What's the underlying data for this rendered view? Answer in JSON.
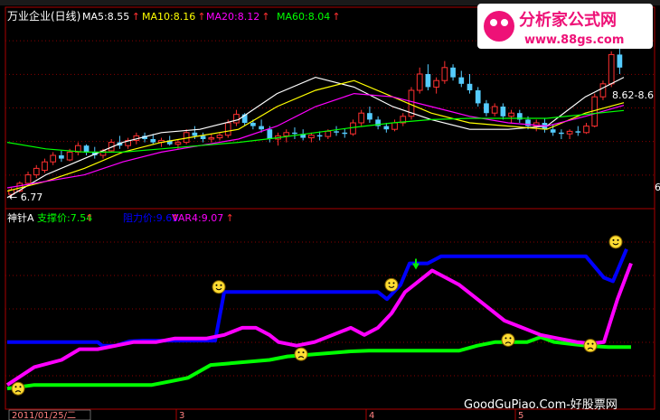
{
  "chart_data": [
    {
      "type": "candlestick",
      "title": "万业企业(日线)",
      "indicators": [
        {
          "label": "MA5:8.55",
          "color": "#ffffff"
        },
        {
          "label": "MA10:8.16",
          "color": "#ffff00"
        },
        {
          "label": "MA20:8.12",
          "color": "#ff00ff"
        },
        {
          "label": "MA60:8.04",
          "color": "#00ff00"
        }
      ],
      "arrow": "↑",
      "ylim": [
        6.6,
        9.35
      ],
      "min_label": "← 6.77",
      "range_label": "8.62-8.6",
      "right_tick": "6",
      "candles": [
        [
          6.75,
          6.85,
          6.7,
          6.82
        ],
        [
          6.8,
          6.95,
          6.78,
          6.92
        ],
        [
          6.92,
          7.1,
          6.9,
          7.05
        ],
        [
          7.05,
          7.2,
          7.0,
          7.15
        ],
        [
          7.12,
          7.3,
          7.08,
          7.25
        ],
        [
          7.25,
          7.4,
          7.2,
          7.35
        ],
        [
          7.35,
          7.42,
          7.25,
          7.3
        ],
        [
          7.28,
          7.45,
          7.26,
          7.4
        ],
        [
          7.4,
          7.55,
          7.35,
          7.5
        ],
        [
          7.5,
          7.52,
          7.35,
          7.4
        ],
        [
          7.4,
          7.48,
          7.3,
          7.35
        ],
        [
          7.35,
          7.45,
          7.3,
          7.42
        ],
        [
          7.42,
          7.6,
          7.4,
          7.55
        ],
        [
          7.55,
          7.65,
          7.45,
          7.5
        ],
        [
          7.5,
          7.62,
          7.45,
          7.58
        ],
        [
          7.58,
          7.7,
          7.52,
          7.65
        ],
        [
          7.65,
          7.7,
          7.55,
          7.6
        ],
        [
          7.6,
          7.68,
          7.52,
          7.55
        ],
        [
          7.55,
          7.62,
          7.48,
          7.58
        ],
        [
          7.58,
          7.65,
          7.5,
          7.52
        ],
        [
          7.52,
          7.6,
          7.45,
          7.55
        ],
        [
          7.55,
          7.75,
          7.52,
          7.7
        ],
        [
          7.7,
          7.8,
          7.6,
          7.65
        ],
        [
          7.65,
          7.7,
          7.55,
          7.6
        ],
        [
          7.6,
          7.68,
          7.55,
          7.62
        ],
        [
          7.62,
          7.7,
          7.58,
          7.66
        ],
        [
          7.66,
          7.9,
          7.62,
          7.85
        ],
        [
          7.85,
          8.05,
          7.8,
          7.98
        ],
        [
          7.98,
          8.0,
          7.8,
          7.85
        ],
        [
          7.85,
          7.9,
          7.75,
          7.8
        ],
        [
          7.8,
          7.9,
          7.7,
          7.75
        ],
        [
          7.75,
          7.8,
          7.55,
          7.6
        ],
        [
          7.6,
          7.7,
          7.5,
          7.65
        ],
        [
          7.65,
          7.75,
          7.55,
          7.7
        ],
        [
          7.7,
          7.78,
          7.6,
          7.68
        ],
        [
          7.68,
          7.75,
          7.58,
          7.62
        ],
        [
          7.62,
          7.7,
          7.55,
          7.66
        ],
        [
          7.66,
          7.72,
          7.58,
          7.64
        ],
        [
          7.64,
          7.75,
          7.6,
          7.72
        ],
        [
          7.72,
          7.8,
          7.65,
          7.7
        ],
        [
          7.7,
          7.76,
          7.62,
          7.68
        ],
        [
          7.68,
          7.9,
          7.65,
          7.85
        ],
        [
          7.85,
          8.05,
          7.8,
          8.0
        ],
        [
          8.0,
          8.1,
          7.85,
          7.9
        ],
        [
          7.9,
          7.95,
          7.75,
          7.8
        ],
        [
          7.8,
          7.85,
          7.7,
          7.75
        ],
        [
          7.75,
          7.9,
          7.72,
          7.85
        ],
        [
          7.85,
          8.0,
          7.8,
          7.95
        ],
        [
          7.95,
          8.4,
          7.9,
          8.35
        ],
        [
          8.35,
          8.7,
          8.3,
          8.6
        ],
        [
          8.6,
          8.75,
          8.35,
          8.4
        ],
        [
          8.4,
          8.55,
          8.3,
          8.5
        ],
        [
          8.5,
          8.8,
          8.45,
          8.7
        ],
        [
          8.7,
          8.75,
          8.5,
          8.55
        ],
        [
          8.55,
          8.65,
          8.4,
          8.45
        ],
        [
          8.45,
          8.6,
          8.3,
          8.35
        ],
        [
          8.35,
          8.4,
          8.1,
          8.15
        ],
        [
          8.15,
          8.2,
          7.95,
          8.0
        ],
        [
          8.0,
          8.15,
          7.95,
          8.1
        ],
        [
          8.1,
          8.15,
          7.9,
          7.95
        ],
        [
          7.95,
          8.05,
          7.85,
          8.0
        ],
        [
          8.0,
          8.05,
          7.85,
          7.9
        ],
        [
          7.9,
          7.95,
          7.75,
          7.8
        ],
        [
          7.8,
          7.9,
          7.72,
          7.85
        ],
        [
          7.85,
          7.92,
          7.7,
          7.75
        ],
        [
          7.75,
          7.82,
          7.65,
          7.7
        ],
        [
          7.7,
          7.75,
          7.6,
          7.68
        ],
        [
          7.68,
          7.75,
          7.6,
          7.72
        ],
        [
          7.72,
          7.8,
          7.65,
          7.7
        ],
        [
          7.7,
          7.85,
          7.68,
          7.8
        ],
        [
          7.8,
          8.3,
          7.78,
          8.25
        ],
        [
          8.25,
          8.5,
          8.2,
          8.45
        ],
        [
          8.45,
          8.95,
          8.4,
          8.9
        ],
        [
          8.9,
          9.2,
          8.6,
          8.7
        ]
      ],
      "ma_lines": [
        {
          "name": "MA5",
          "color": "#ffffff",
          "values": [
            6.7,
            7.05,
            7.3,
            7.55,
            7.7,
            7.75,
            7.9,
            8.3,
            8.55,
            8.4,
            8.1,
            7.9,
            7.75,
            7.75,
            7.8,
            8.25,
            8.55
          ]
        },
        {
          "name": "MA10",
          "color": "#ffff00",
          "values": [
            6.8,
            6.95,
            7.15,
            7.4,
            7.55,
            7.65,
            7.75,
            8.1,
            8.35,
            8.5,
            8.25,
            8.0,
            7.85,
            7.8,
            7.75,
            8.0,
            8.16
          ]
        },
        {
          "name": "MA20",
          "color": "#ff00ff",
          "values": [
            6.85,
            6.95,
            7.05,
            7.25,
            7.4,
            7.5,
            7.6,
            7.8,
            8.1,
            8.3,
            8.25,
            8.1,
            7.95,
            7.85,
            7.8,
            7.95,
            8.12
          ]
        },
        {
          "name": "MA60",
          "color": "#00ff00",
          "values": [
            7.55,
            7.45,
            7.4,
            7.4,
            7.45,
            7.5,
            7.55,
            7.62,
            7.7,
            7.78,
            7.85,
            7.9,
            7.92,
            7.92,
            7.92,
            7.98,
            8.04
          ]
        }
      ]
    },
    {
      "type": "line",
      "title": "神针A",
      "series": [
        {
          "name": "支撑价",
          "label": "支撑价:7.54",
          "color": "#00ff00",
          "x": [
            0,
            30,
            160,
            180,
            200,
            225,
            290,
            310,
            360,
            380,
            400,
            500,
            520,
            540,
            575,
            590,
            605,
            640,
            665,
            690
          ],
          "y": [
            2.5,
            3.0,
            3.0,
            3.5,
            4.0,
            5.8,
            6.5,
            7.0,
            7.5,
            7.7,
            7.8,
            7.8,
            8.5,
            9.0,
            9.0,
            9.7,
            9.0,
            8.5,
            8.3,
            8.3
          ]
        },
        {
          "name": "阻力价",
          "label": "阻力价:9.65",
          "color": "#0000ff",
          "x": [
            0,
            100,
            105,
            120,
            135,
            150,
            185,
            230,
            240,
            410,
            420,
            435,
            445,
            465,
            480,
            640,
            660,
            670,
            685
          ],
          "y": [
            9.0,
            9.0,
            8.5,
            8.5,
            9.1,
            9.2,
            9.2,
            9.2,
            16.0,
            16.0,
            15.0,
            17.0,
            20.0,
            20.0,
            21.0,
            21.0,
            18.0,
            17.5,
            22.0
          ]
        },
        {
          "name": "VAR4",
          "label": "VAR4:9.07",
          "color": "#ff00ff",
          "x": [
            0,
            30,
            60,
            80,
            100,
            120,
            140,
            165,
            185,
            200,
            220,
            240,
            260,
            275,
            290,
            300,
            320,
            340,
            360,
            380,
            395,
            410,
            425,
            440,
            450,
            470,
            485,
            500,
            510,
            530,
            550,
            570,
            590,
            610,
            630,
            645,
            660,
            675,
            690
          ],
          "y": [
            3.0,
            5.5,
            6.5,
            8.0,
            8.0,
            8.5,
            9.0,
            9.0,
            9.5,
            9.5,
            9.5,
            10.0,
            11.0,
            11.0,
            10.0,
            9.0,
            8.5,
            9.0,
            10.0,
            11.0,
            10.0,
            11.0,
            13.0,
            16.0,
            17.0,
            19.0,
            18.0,
            17.0,
            16.0,
            14.0,
            12.0,
            11.0,
            10.0,
            9.5,
            9.0,
            8.8,
            9.0,
            15.0,
            20.0
          ]
        }
      ],
      "smileys": [
        {
          "x": 20,
          "y": 2.5,
          "mood": "sad"
        },
        {
          "x": 242,
          "y": 16.7,
          "mood": "happy"
        },
        {
          "x": 433,
          "y": 17.0,
          "mood": "happy"
        },
        {
          "x": 333,
          "y": 7.3,
          "mood": "sad"
        },
        {
          "x": 562,
          "y": 9.3,
          "mood": "sad"
        },
        {
          "x": 653,
          "y": 8.5,
          "mood": "sad"
        },
        {
          "x": 681,
          "y": 23.0,
          "mood": "happy"
        }
      ],
      "down_arrow": {
        "x": 460,
        "y": 19.5
      },
      "ylim": [
        0,
        25
      ]
    }
  ],
  "xaxis": {
    "date_label": "2011/01/25/二",
    "month_ticks": [
      {
        "label": "3",
        "x": 195
      },
      {
        "label": "4",
        "x": 405
      },
      {
        "label": "5",
        "x": 570
      }
    ]
  },
  "watermark": {
    "brand": "分析家公式网",
    "url": "www.88gs.com",
    "site": "GoodGuPiao.Com-好股票网"
  },
  "colors": {
    "up": "#ff3030",
    "down": "#55ccff",
    "grid": "#880000",
    "frame": "#aa0000"
  }
}
